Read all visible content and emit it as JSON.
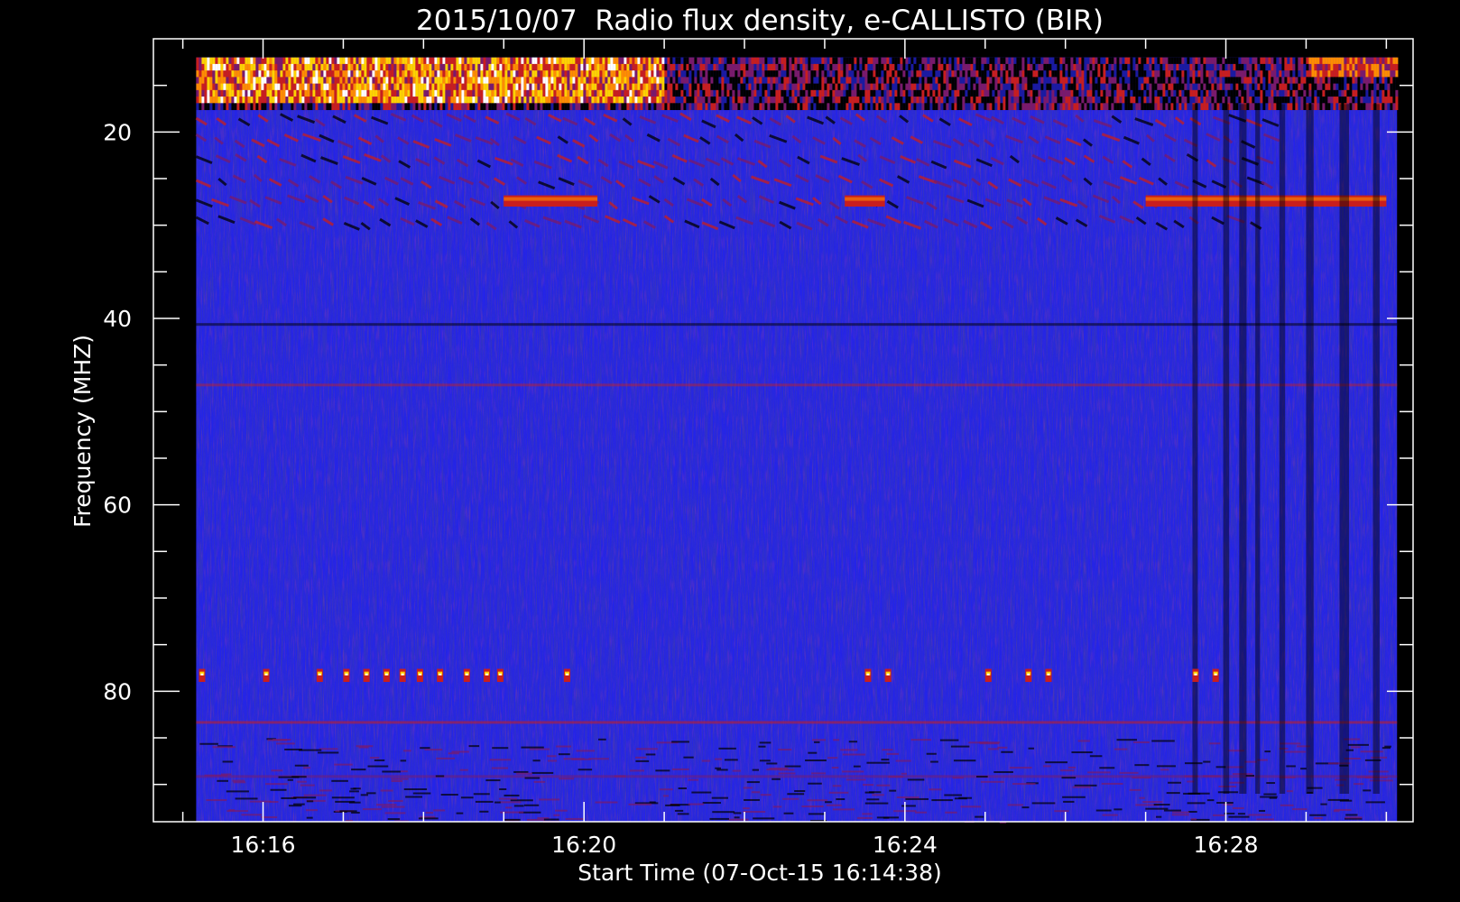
{
  "chart_data": {
    "type": "heatmap",
    "title": "2015/10/07  Radio flux density, e-CALLISTO (BIR)",
    "xlabel": "Start Time (07-Oct-15 16:14:38)",
    "ylabel": "Frequency (MHZ)",
    "x_unit": "time (HH:MM)",
    "xlim": [
      "16:14:38",
      "16:30:20"
    ],
    "data_time_range": [
      "16:15:10",
      "16:30:08"
    ],
    "ylim": [
      94,
      10
    ],
    "data_freq_range": [
      12,
      94
    ],
    "x_ticks": [
      {
        "time": "16:16",
        "label": "16:16"
      },
      {
        "time": "16:20",
        "label": "16:20"
      },
      {
        "time": "16:24",
        "label": "16:24"
      },
      {
        "time": "16:28",
        "label": "16:28"
      }
    ],
    "x_minor_ticks": [
      "16:15",
      "16:17",
      "16:18",
      "16:19",
      "16:21",
      "16:22",
      "16:23",
      "16:25",
      "16:26",
      "16:27",
      "16:29",
      "16:30"
    ],
    "y_ticks": [
      {
        "value": 20,
        "label": "20"
      },
      {
        "value": 40,
        "label": "40"
      },
      {
        "value": 60,
        "label": "60"
      },
      {
        "value": 80,
        "label": "80"
      }
    ],
    "y_minor_ticks": [
      15,
      25,
      30,
      35,
      45,
      50,
      55,
      65,
      70,
      75,
      85,
      90
    ],
    "colormap": [
      "#000000",
      "#1a1aa0",
      "#2c2cf0",
      "#7a1a6a",
      "#c81e1e",
      "#ff8c00",
      "#ffd200",
      "#ffffff"
    ],
    "background_level": "#2424e8",
    "features": {
      "intense_band": {
        "freq_range": [
          12,
          17
        ],
        "time_range": [
          "16:15:10",
          "16:21:00"
        ],
        "level": "high"
      },
      "intense_band_late": {
        "freq_range": [
          12,
          14
        ],
        "time_range": [
          "16:29:00",
          "16:30:08"
        ],
        "level": "high"
      },
      "stripe_bursts": {
        "freq_range": [
          18,
          31
        ],
        "time_range": [
          "16:15:10",
          "16:28:30"
        ],
        "level": "moderate"
      },
      "band_27MHz": [
        {
          "time_range": [
            "16:19:00",
            "16:20:10"
          ]
        },
        {
          "time_range": [
            "16:23:15",
            "16:23:45"
          ]
        },
        {
          "time_range": [
            "16:27:00",
            "16:30:00"
          ]
        }
      ],
      "spots_78MHz": [
        "16:15:12",
        "16:16:00",
        "16:16:40",
        "16:17:00",
        "16:17:15",
        "16:17:30",
        "16:17:42",
        "16:17:55",
        "16:18:10",
        "16:18:30",
        "16:18:45",
        "16:18:55",
        "16:19:45",
        "16:23:30",
        "16:23:45",
        "16:25:00",
        "16:25:30",
        "16:25:45",
        "16:27:35",
        "16:27:50"
      ],
      "dark_columns": [
        "16:27:35",
        "16:27:58",
        "16:28:10",
        "16:28:22",
        "16:28:40",
        "16:29:00",
        "16:29:25",
        "16:29:50"
      ]
    }
  }
}
